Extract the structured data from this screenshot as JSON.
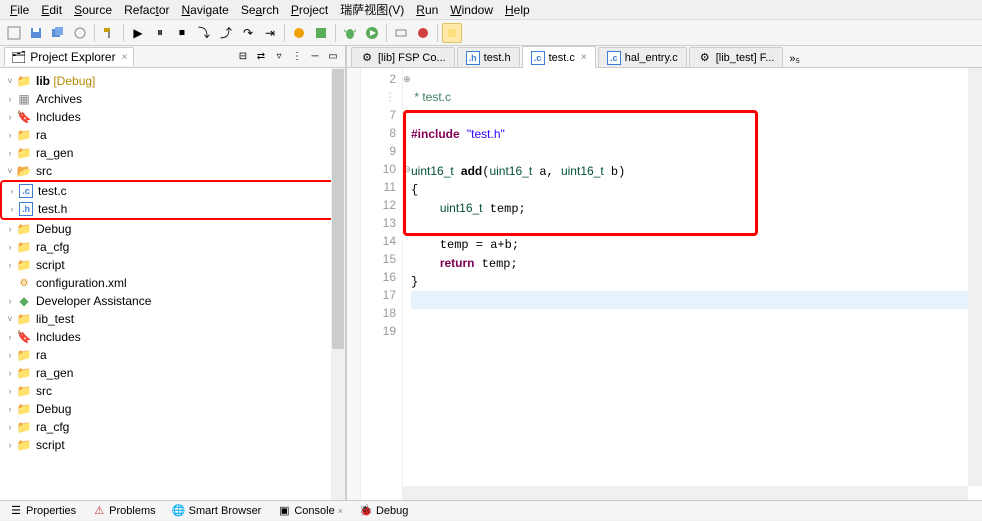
{
  "menu": {
    "items": [
      "File",
      "Edit",
      "Source",
      "Refactor",
      "Navigate",
      "Search",
      "Project",
      "瑞萨视图(V)",
      "Run",
      "Window",
      "Help"
    ]
  },
  "project_explorer": {
    "title": "Project Explorer"
  },
  "tree": {
    "lib": {
      "name": "lib",
      "tag": "[Debug]"
    },
    "archives": "Archives",
    "includes": "Includes",
    "ra": "ra",
    "ra_gen": "ra_gen",
    "src": "src",
    "test_c": "test.c",
    "test_h": "test.h",
    "debug": "Debug",
    "ra_cfg": "ra_cfg",
    "script": "script",
    "config_xml": "configuration.xml",
    "dev_assist": "Developer Assistance",
    "lib_test": "lib_test",
    "lt_includes": "Includes",
    "lt_ra": "ra",
    "lt_ra_gen": "ra_gen",
    "lt_src": "src",
    "lt_debug": "Debug",
    "lt_ra_cfg": "ra_cfg",
    "lt_script": "script"
  },
  "editor_tabs": {
    "t0": "[lib] FSP Co...",
    "t1": "test.h",
    "t2": "test.c",
    "t3": "hal_entry.c",
    "t4": "[lib_test] F...",
    "more": "»₅"
  },
  "code": {
    "comment_tail": " * test.c",
    "include": "#include",
    "include_str": "\"test.h\"",
    "line10": "uint16_t add(uint16_t a, uint16_t b)",
    "line11": "{",
    "line12": "    uint16_t temp;",
    "line14": "    temp = a+b;",
    "line15": "    return temp;",
    "line16": "}",
    "line_numbers": [
      "2",
      "",
      "7",
      "8",
      "9",
      "10",
      "11",
      "12",
      "13",
      "14",
      "15",
      "16",
      "17",
      "18",
      "19"
    ]
  },
  "bottom": {
    "properties": "Properties",
    "problems": "Problems",
    "smart_browser": "Smart Browser",
    "console": "Console",
    "debug": "Debug"
  }
}
